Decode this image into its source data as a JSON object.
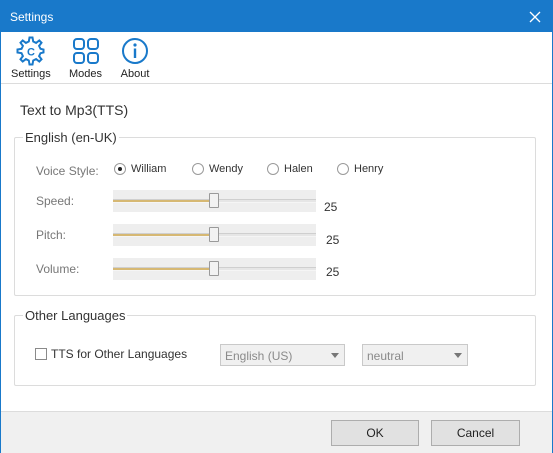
{
  "window": {
    "title": "Settings"
  },
  "toolbar": {
    "items": [
      {
        "label": "Settings",
        "icon": "gear-icon"
      },
      {
        "label": "Modes",
        "icon": "grid-icon"
      },
      {
        "label": "About",
        "icon": "info-icon"
      }
    ]
  },
  "page": {
    "heading": "Text to Mp3(TTS)"
  },
  "english": {
    "legend": "English (en-UK)",
    "voice_label": "Voice Style:",
    "voices": [
      "William",
      "Wendy",
      "Halen",
      "Henry"
    ],
    "selected_voice": "William",
    "speed_label": "Speed:",
    "speed_value": "25",
    "pitch_label": "Pitch:",
    "pitch_value": "25",
    "volume_label": "Volume:",
    "volume_value": "25"
  },
  "other": {
    "legend": "Other Languages",
    "checkbox_label": "TTS for Other Languages",
    "language_value": "English (US)",
    "style_value": "neutral"
  },
  "footer": {
    "ok_label": "OK",
    "cancel_label": "Cancel"
  },
  "colors": {
    "titlebar": "#1979ca",
    "accent_icon": "#1979ca",
    "slider_fill": "#d6b873"
  }
}
